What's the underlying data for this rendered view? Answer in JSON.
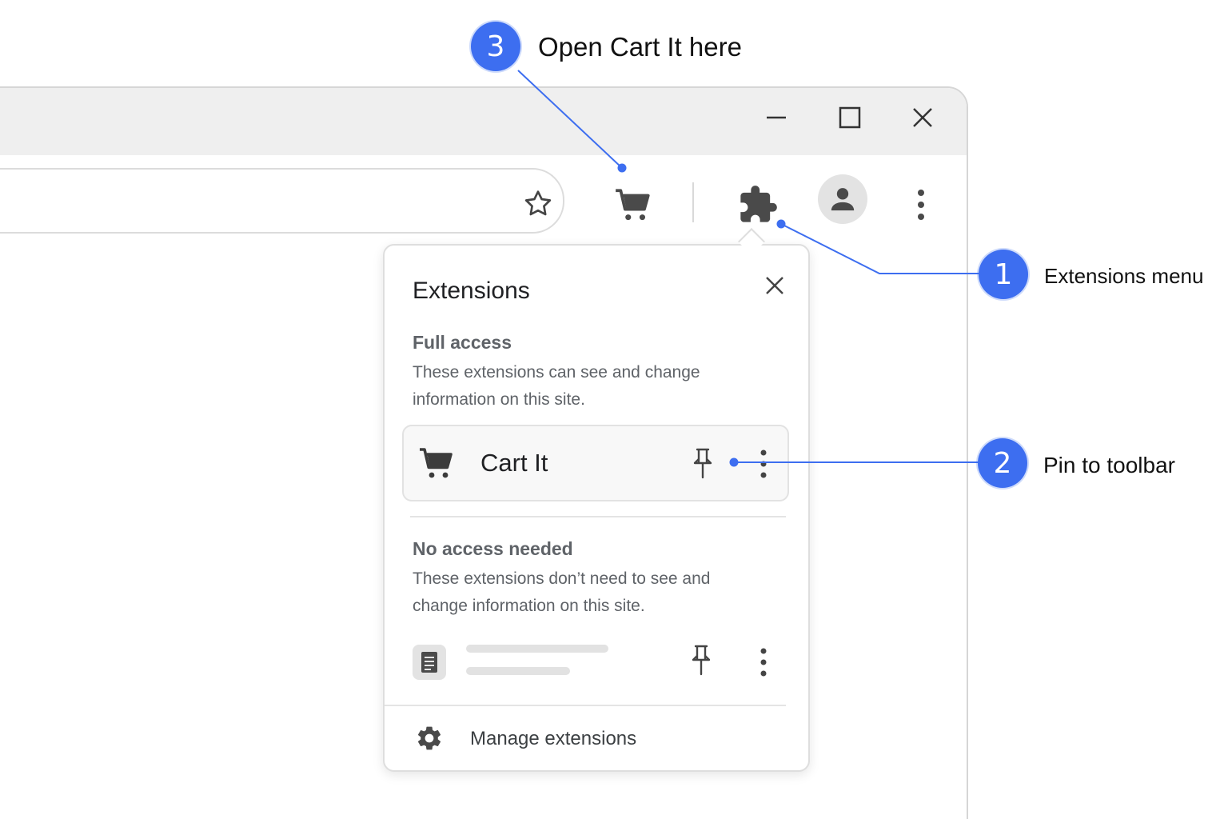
{
  "browser": {
    "window_controls": {
      "minimize_icon": "minimize-icon",
      "maximize_icon": "maximize-icon",
      "close_icon": "close-icon"
    },
    "toolbar": {
      "bookmark_icon": "star-icon",
      "cart_extension_icon": "cart-icon",
      "extensions_icon": "puzzle-icon",
      "profile_icon": "person-icon",
      "menu_icon": "more-vert-icon"
    }
  },
  "popup": {
    "title": "Extensions",
    "full_access": {
      "heading": "Full access",
      "description": "These extensions can see and change information on this site.",
      "extension": {
        "name": "Cart It",
        "icon": "cart-icon",
        "pin_icon": "pin-icon",
        "more_icon": "more-vert-icon"
      }
    },
    "no_access": {
      "heading": "No access needed",
      "description": "These extensions don’t need to see and change information on this site.",
      "extension": {
        "icon": "document-icon",
        "pin_icon": "pin-icon",
        "more_icon": "more-vert-icon"
      }
    },
    "manage": {
      "label": "Manage extensions",
      "icon": "gear-icon"
    }
  },
  "callouts": [
    {
      "number": "1",
      "label": "Extensions menu"
    },
    {
      "number": "2",
      "label": "Pin to toolbar"
    },
    {
      "number": "3",
      "label": "Open Cart It here"
    }
  ],
  "colors": {
    "accent": "#3d6ef0",
    "titlebar": "#efefef",
    "icon": "#4a4a4a"
  }
}
